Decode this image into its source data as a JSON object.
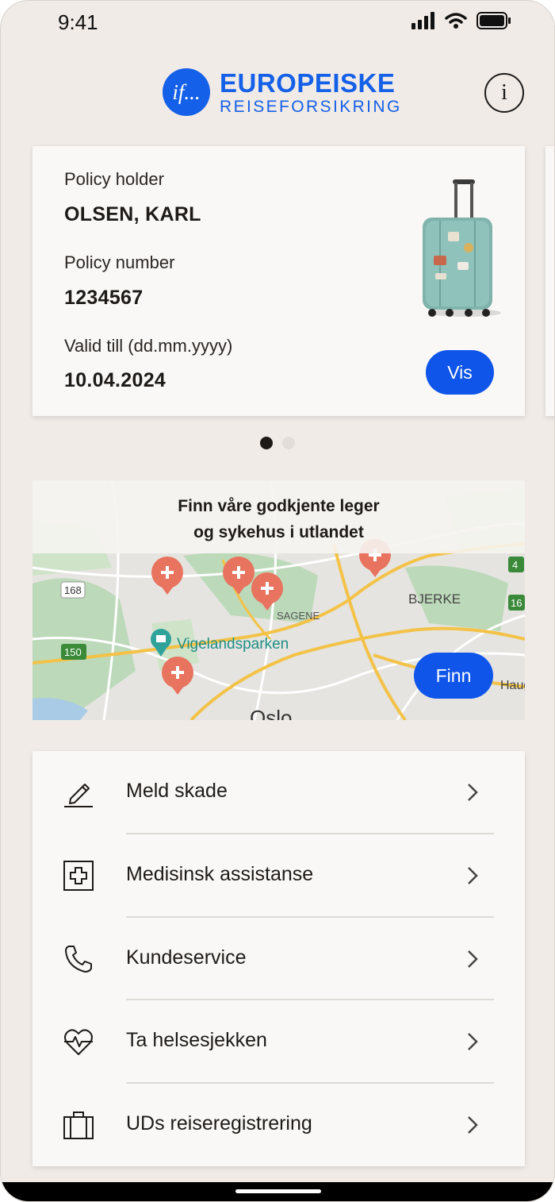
{
  "status_bar": {
    "time": "9:41"
  },
  "header": {
    "logo_mark": "if...",
    "brand_title": "EUROPEISKE",
    "brand_subtitle": "REISEFORSIKRING",
    "info_icon": "info-icon"
  },
  "policy_card": {
    "holder_label": "Policy holder",
    "holder_value": "OLSEN, KARL",
    "number_label": "Policy number",
    "number_value": "1234567",
    "valid_label": "Valid till (dd.mm.yyyy)",
    "valid_value": "10.04.2024",
    "vis_button": "Vis",
    "image": "suitcase-icon"
  },
  "pagination": {
    "count": 2,
    "active": 1
  },
  "map_card": {
    "title_line1": "Finn våre godkjente leger",
    "title_line2": "og sykehus i utlandet",
    "labels": {
      "bjerke": "BJERKE",
      "sagene": "SAGENE",
      "vigelandsparken": "Vigelandsparken",
      "road_168": "168",
      "road_150": "150",
      "road_4": "4",
      "road_16": "16",
      "haugen": "Hauge",
      "oslo": "Oslo"
    },
    "finn_button": "Finn"
  },
  "menu": {
    "items": [
      {
        "label": "Meld skade",
        "icon": "pencil-icon"
      },
      {
        "label": "Medisinsk assistanse",
        "icon": "medical-cross-icon"
      },
      {
        "label": "Kundeservice",
        "icon": "phone-icon"
      },
      {
        "label": "Ta helsesjekken",
        "icon": "heart-pulse-icon"
      },
      {
        "label": "UDs reiseregistrering",
        "icon": "briefcase-icon"
      }
    ]
  },
  "colors": {
    "background": "#f0ebe7",
    "card": "#faf8f6",
    "accent": "#0f55ea",
    "brand": "#1560e8",
    "map_pin": "#e8735f",
    "text": "#1e1a17"
  }
}
